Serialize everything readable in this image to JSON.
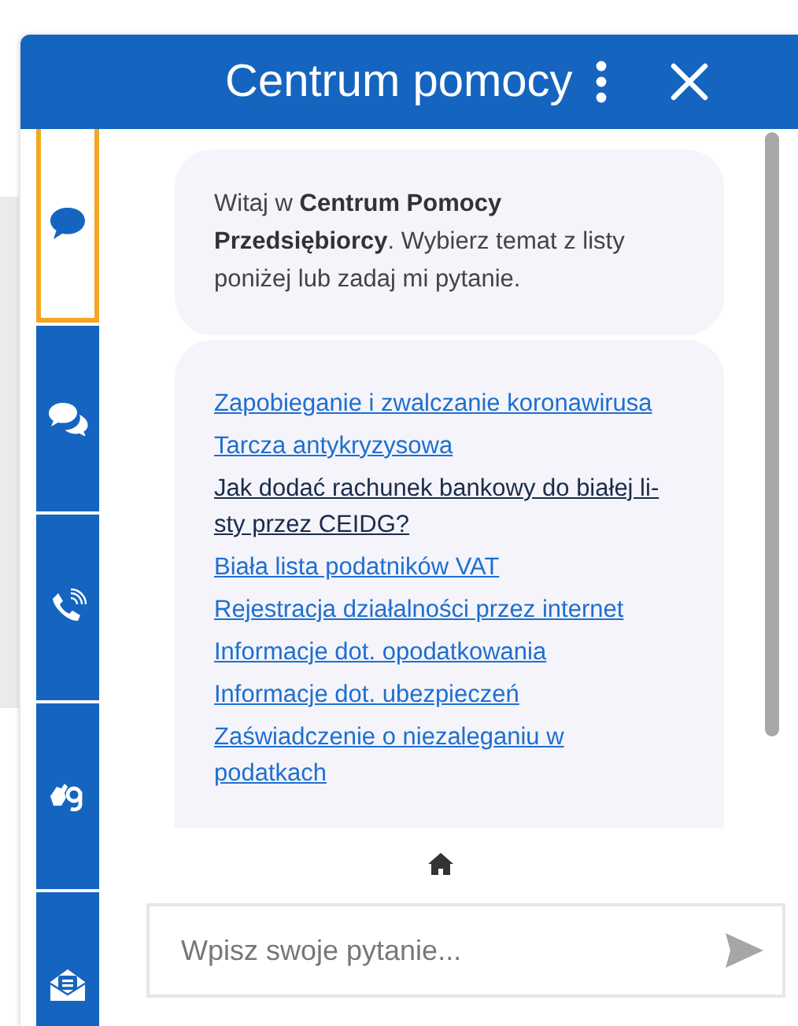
{
  "header": {
    "title": "Centrum pomocy"
  },
  "sidebar": {
    "tabs": [
      {
        "kind": "chat",
        "selected": true
      },
      {
        "kind": "chats",
        "selected": false
      },
      {
        "kind": "phone",
        "selected": false
      },
      {
        "kind": "sign-language",
        "selected": false
      },
      {
        "kind": "mail",
        "selected": false
      }
    ]
  },
  "messages": [
    {
      "kind": "text",
      "text": "Witaj w **Centrum Pomocy Przedsiębiorcy**. Wybierz temat z listy poniżej lub zadaj mi pytanie."
    },
    {
      "kind": "links",
      "links": [
        {
          "text": "Zapobieganie i zwalczanie koronawirusa",
          "visited": false
        },
        {
          "text": "Tarcza antykryzysowa",
          "visited": false
        },
        {
          "text": "Jak dodać rachunek bankowy do białej li-sty przez CEIDG?",
          "visited": true
        },
        {
          "text": "Biała lista podatników VAT",
          "visited": false
        },
        {
          "text": "Rejestracja działalności przez internet",
          "visited": false
        },
        {
          "text": "Informacje dot. opodatkowania",
          "visited": false
        },
        {
          "text": "Informacje dot. ubezpieczeń",
          "visited": false
        },
        {
          "text": "Zaświadczenie o niezaleganiu w podatkach",
          "visited": false
        }
      ]
    }
  ],
  "input": {
    "placeholder": "Wpisz swoje pytanie..."
  }
}
